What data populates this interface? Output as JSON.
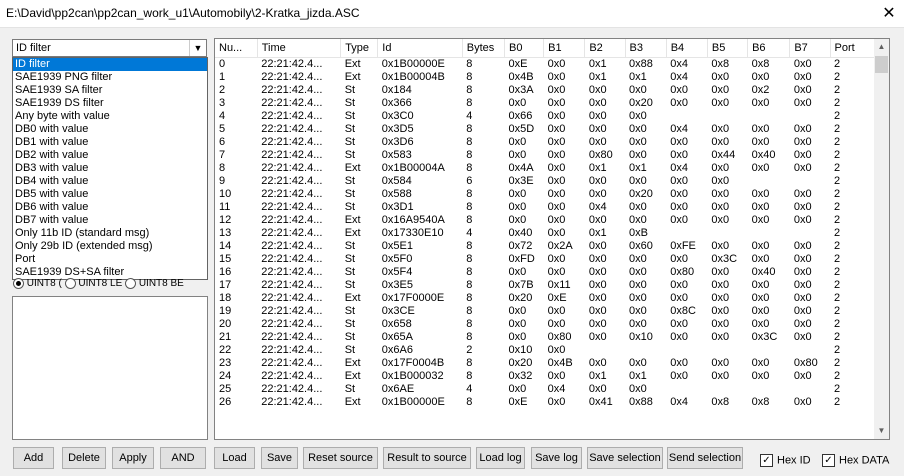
{
  "window": {
    "title": "E:\\David\\pp2can\\pp2can_work_u1\\Automobily\\2-Kratka_jizda.ASC",
    "close_glyph": "✕"
  },
  "filter": {
    "selected": "ID filter",
    "options": [
      "ID filter",
      "SAE1939 PNG filter",
      "SAE1939 SA filter",
      "SAE1939 DS filter",
      "Any byte with value",
      "DB0 with value",
      "DB1 with value",
      "DB2 with value",
      "DB3 with value",
      "DB4 with value",
      "DB5 with value",
      "DB6 with value",
      "DB7 with value",
      "Only 11b ID (standard msg)",
      "Only 29b ID (extended msg)",
      "Port",
      "SAE1939 DS+SA filter"
    ],
    "radios": [
      "UINT8 (",
      "UINT8 LE",
      "UINT8 BE"
    ]
  },
  "left_buttons": [
    "Add",
    "Delete",
    "Apply",
    "AND"
  ],
  "bottom_buttons": [
    "Load",
    "Save",
    "Reset source",
    "Result to source",
    "Load log",
    "Save log",
    "Save selection",
    "Send selection"
  ],
  "checkboxes": [
    {
      "label": "Hex ID",
      "checked": true
    },
    {
      "label": "Hex DATA",
      "checked": true
    }
  ],
  "grid": {
    "columns": [
      "Nu...",
      "Time",
      "Type",
      "Id",
      "Bytes",
      "B0",
      "B1",
      "B2",
      "B3",
      "B4",
      "B5",
      "B6",
      "B7",
      "Port"
    ],
    "rows": [
      [
        "0",
        "22:21:42.4...",
        "Ext",
        "0x1B00000E",
        "8",
        "0xE",
        "0x0",
        "0x1",
        "0x88",
        "0x4",
        "0x8",
        "0x8",
        "0x0",
        "2"
      ],
      [
        "1",
        "22:21:42.4...",
        "Ext",
        "0x1B00004B",
        "8",
        "0x4B",
        "0x0",
        "0x1",
        "0x1",
        "0x4",
        "0x0",
        "0x0",
        "0x0",
        "2"
      ],
      [
        "2",
        "22:21:42.4...",
        "St",
        "0x184",
        "8",
        "0x3A",
        "0x0",
        "0x0",
        "0x0",
        "0x0",
        "0x0",
        "0x2",
        "0x0",
        "2"
      ],
      [
        "3",
        "22:21:42.4...",
        "St",
        "0x366",
        "8",
        "0x0",
        "0x0",
        "0x0",
        "0x20",
        "0x0",
        "0x0",
        "0x0",
        "0x0",
        "2"
      ],
      [
        "4",
        "22:21:42.4...",
        "St",
        "0x3C0",
        "4",
        "0x66",
        "0x0",
        "0x0",
        "0x0",
        "",
        "",
        "",
        "",
        "2"
      ],
      [
        "5",
        "22:21:42.4...",
        "St",
        "0x3D5",
        "8",
        "0x5D",
        "0x0",
        "0x0",
        "0x0",
        "0x4",
        "0x0",
        "0x0",
        "0x0",
        "2"
      ],
      [
        "6",
        "22:21:42.4...",
        "St",
        "0x3D6",
        "8",
        "0x0",
        "0x0",
        "0x0",
        "0x0",
        "0x0",
        "0x0",
        "0x0",
        "0x0",
        "2"
      ],
      [
        "7",
        "22:21:42.4...",
        "St",
        "0x583",
        "8",
        "0x0",
        "0x0",
        "0x80",
        "0x0",
        "0x0",
        "0x44",
        "0x40",
        "0x0",
        "2"
      ],
      [
        "8",
        "22:21:42.4...",
        "Ext",
        "0x1B00004A",
        "8",
        "0x4A",
        "0x0",
        "0x1",
        "0x1",
        "0x4",
        "0x0",
        "0x0",
        "0x0",
        "2"
      ],
      [
        "9",
        "22:21:42.4...",
        "St",
        "0x584",
        "6",
        "0x3E",
        "0x0",
        "0x0",
        "0x0",
        "0x0",
        "0x0",
        "",
        "",
        "2"
      ],
      [
        "10",
        "22:21:42.4...",
        "St",
        "0x588",
        "8",
        "0x0",
        "0x0",
        "0x0",
        "0x20",
        "0x0",
        "0x0",
        "0x0",
        "0x0",
        "2"
      ],
      [
        "11",
        "22:21:42.4...",
        "St",
        "0x3D1",
        "8",
        "0x0",
        "0x0",
        "0x4",
        "0x0",
        "0x0",
        "0x0",
        "0x0",
        "0x0",
        "2"
      ],
      [
        "12",
        "22:21:42.4...",
        "Ext",
        "0x16A9540A",
        "8",
        "0x0",
        "0x0",
        "0x0",
        "0x0",
        "0x0",
        "0x0",
        "0x0",
        "0x0",
        "2"
      ],
      [
        "13",
        "22:21:42.4...",
        "Ext",
        "0x17330E10",
        "4",
        "0x40",
        "0x0",
        "0x1",
        "0xB",
        "",
        "",
        "",
        "",
        "2"
      ],
      [
        "14",
        "22:21:42.4...",
        "St",
        "0x5E1",
        "8",
        "0x72",
        "0x2A",
        "0x0",
        "0x60",
        "0xFE",
        "0x0",
        "0x0",
        "0x0",
        "2"
      ],
      [
        "15",
        "22:21:42.4...",
        "St",
        "0x5F0",
        "8",
        "0xFD",
        "0x0",
        "0x0",
        "0x0",
        "0x0",
        "0x3C",
        "0x0",
        "0x0",
        "2"
      ],
      [
        "16",
        "22:21:42.4...",
        "St",
        "0x5F4",
        "8",
        "0x0",
        "0x0",
        "0x0",
        "0x0",
        "0x80",
        "0x0",
        "0x40",
        "0x0",
        "2"
      ],
      [
        "17",
        "22:21:42.4...",
        "St",
        "0x3E5",
        "8",
        "0x7B",
        "0x11",
        "0x0",
        "0x0",
        "0x0",
        "0x0",
        "0x0",
        "0x0",
        "2"
      ],
      [
        "18",
        "22:21:42.4...",
        "Ext",
        "0x17F0000E",
        "8",
        "0x20",
        "0xE",
        "0x0",
        "0x0",
        "0x0",
        "0x0",
        "0x0",
        "0x0",
        "2"
      ],
      [
        "19",
        "22:21:42.4...",
        "St",
        "0x3CE",
        "8",
        "0x0",
        "0x0",
        "0x0",
        "0x0",
        "0x8C",
        "0x0",
        "0x0",
        "0x0",
        "2"
      ],
      [
        "20",
        "22:21:42.4...",
        "St",
        "0x658",
        "8",
        "0x0",
        "0x0",
        "0x0",
        "0x0",
        "0x0",
        "0x0",
        "0x0",
        "0x0",
        "2"
      ],
      [
        "21",
        "22:21:42.4...",
        "St",
        "0x65A",
        "8",
        "0x0",
        "0x80",
        "0x0",
        "0x10",
        "0x0",
        "0x0",
        "0x3C",
        "0x0",
        "2"
      ],
      [
        "22",
        "22:21:42.4...",
        "St",
        "0x6A6",
        "2",
        "0x10",
        "0x0",
        "",
        "",
        "",
        "",
        "",
        "",
        "2"
      ],
      [
        "23",
        "22:21:42.4...",
        "Ext",
        "0x17F0004B",
        "8",
        "0x20",
        "0x4B",
        "0x0",
        "0x0",
        "0x0",
        "0x0",
        "0x0",
        "0x80",
        "2"
      ],
      [
        "24",
        "22:21:42.4...",
        "Ext",
        "0x1B000032",
        "8",
        "0x32",
        "0x0",
        "0x1",
        "0x1",
        "0x0",
        "0x0",
        "0x0",
        "0x0",
        "2"
      ],
      [
        "25",
        "22:21:42.4...",
        "St",
        "0x6AE",
        "4",
        "0x0",
        "0x4",
        "0x0",
        "0x0",
        "",
        "",
        "",
        "",
        "2"
      ],
      [
        "26",
        "22:21:42.4...",
        "Ext",
        "0x1B00000E",
        "8",
        "0xE",
        "0x0",
        "0x41",
        "0x88",
        "0x4",
        "0x8",
        "0x8",
        "0x0",
        "2"
      ]
    ]
  }
}
